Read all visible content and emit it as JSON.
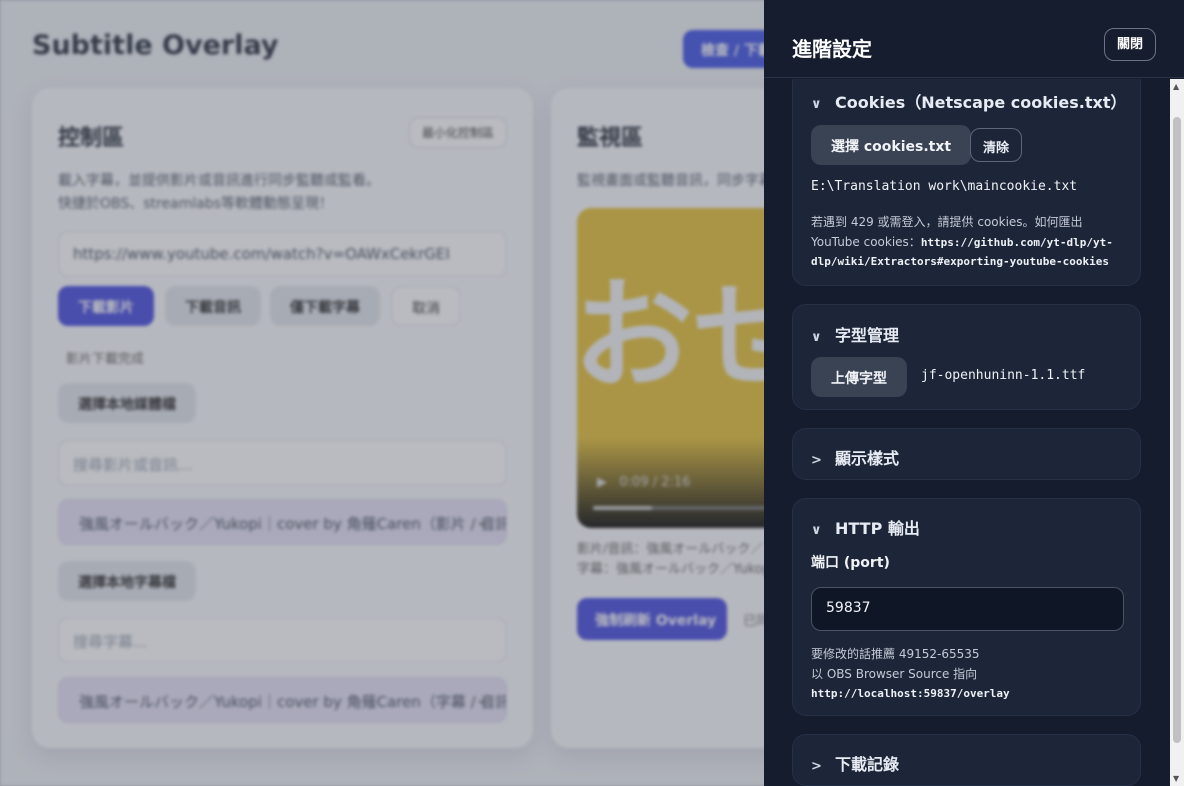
{
  "app": {
    "title": "Subtitle Overlay",
    "top_button": "檢查 / 下載",
    "control": {
      "title": "控制區",
      "minimize": "最小化控制區",
      "desc_line1": "載入字幕，並提供影片或音訊進行同步監聽或監看。",
      "desc_line2": "快捷於OBS、streamlabs等軟體動態呈現！",
      "url_value": "https://www.youtube.com/watch?v=OAWxCekrGEI",
      "btn_download_video": "下載影片",
      "btn_download_audio": "下載音訊",
      "btn_download_subs": "僅下載字幕",
      "btn_cancel": "取消",
      "status": "影片下載完成",
      "btn_local_media": "選擇本地媒體檔",
      "search_media_placeholder": "搜尋影片或音訊...",
      "media_selected": "強風オールバック／Yukopi｜cover by 角薙Caren（影片 / 音訊）",
      "btn_local_subs": "選擇本地字幕檔",
      "search_subs_placeholder": "搜尋字幕...",
      "subs_selected": "強風オールバック／Yukopi｜cover by 角薙Caren（字幕 / 音訊）"
    },
    "monitor": {
      "title": "監視區",
      "desc": "監視畫面或監聽音訊，同步字幕",
      "video_text": "おせ",
      "video_time": "0:09 / 2:16",
      "progress": 0.28,
      "info_line1": "影片/音訊：強風オールバック／",
      "info_line2": "字幕：強風オールバック／Yukopi",
      "force_button": "強制刷新 Overlay",
      "trailing": "已同"
    }
  },
  "drawer": {
    "title": "進階設定",
    "close": "關閉",
    "cookies": {
      "heading": "Cookies（Netscape cookies.txt）",
      "choose": "選擇 cookies.txt",
      "clear": "清除",
      "path": "E:\\Translation work\\maincookie.txt",
      "note_text": "若遇到 429 或需登入，請提供 cookies。如何匯出 YouTube cookies：",
      "note_link": "https://github.com/yt-dlp/yt-dlp/wiki/Extractors#exporting-youtube-cookies"
    },
    "fonts": {
      "heading": "字型管理",
      "upload": "上傳字型",
      "current": "jf-openhuninn-1.1.ttf"
    },
    "display": {
      "heading": "顯示樣式"
    },
    "http": {
      "heading": "HTTP 輸出",
      "port_label": "端口 (port)",
      "port_value": "59837",
      "note_line1": "要修改的話推薦 49152-65535",
      "note_line2": "以 OBS Browser Source 指向",
      "note_url": "http://localhost:59837/overlay"
    },
    "history": {
      "heading": "下載記錄"
    }
  }
}
